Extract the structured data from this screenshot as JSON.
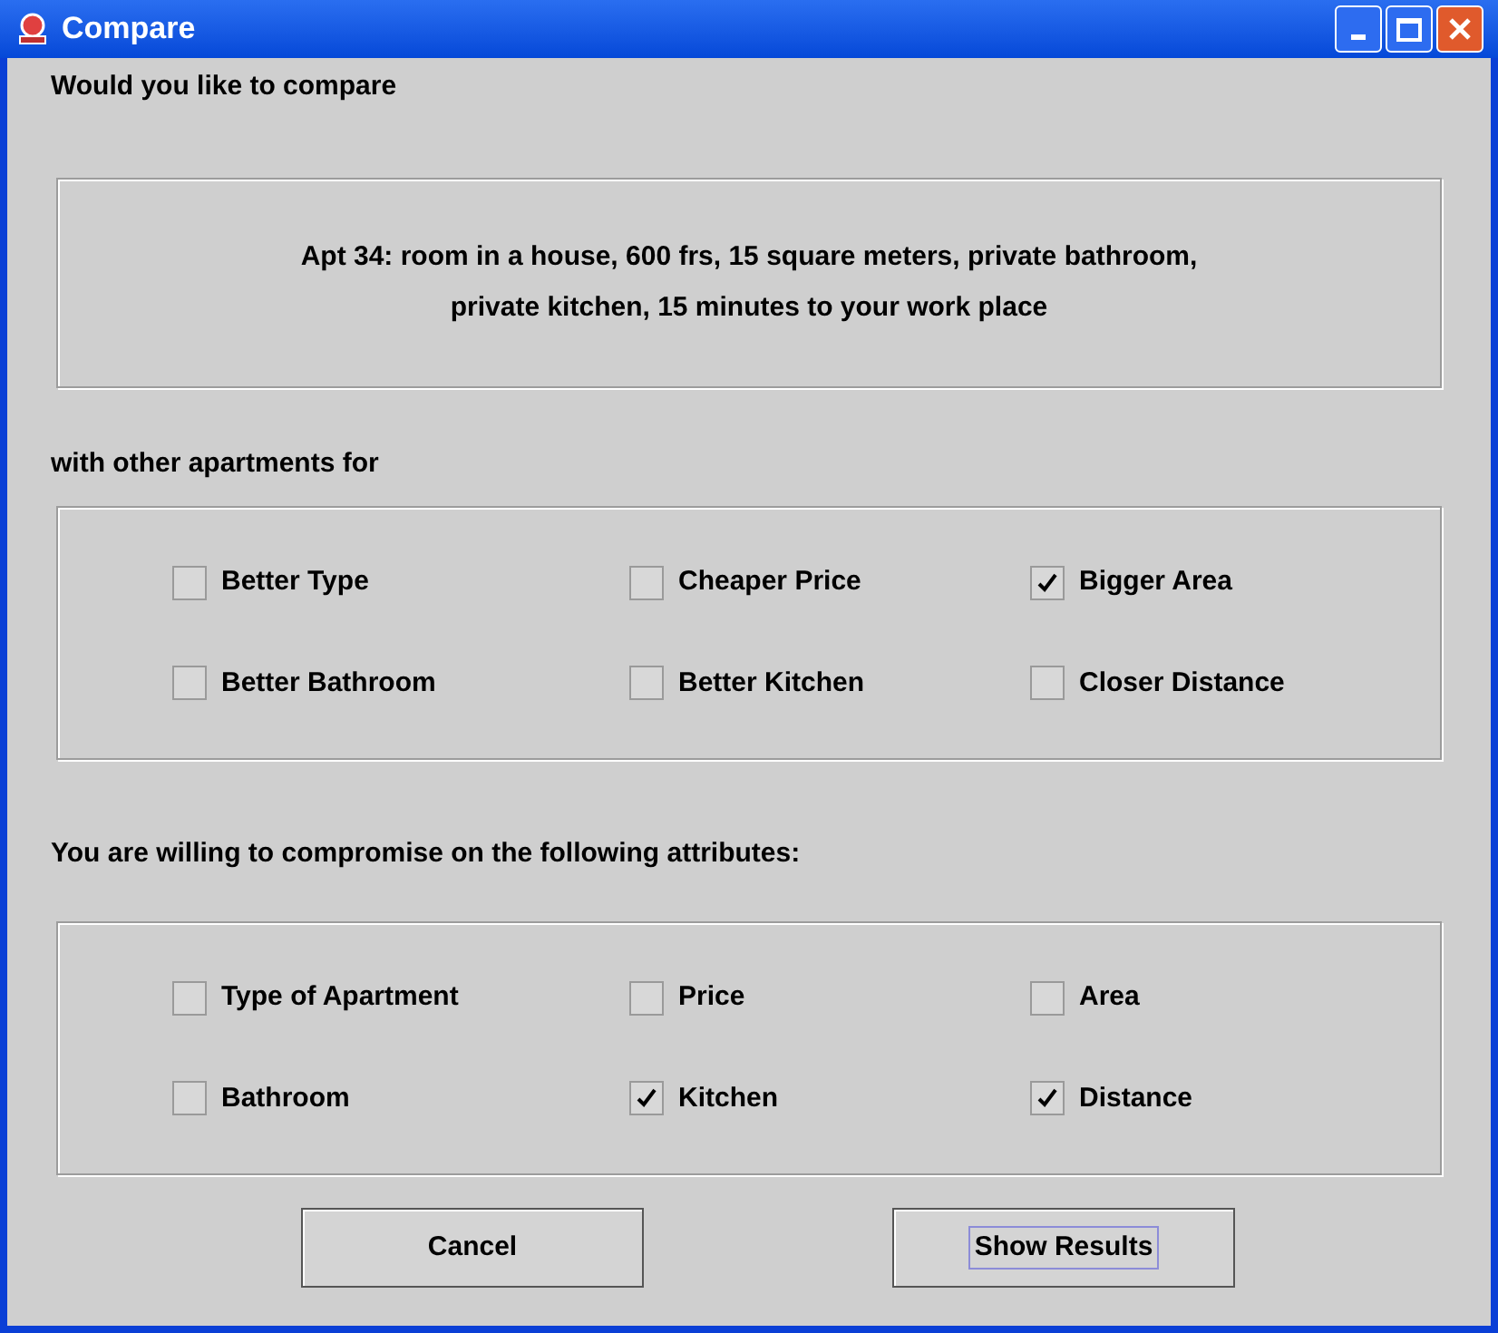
{
  "window": {
    "title": "Compare"
  },
  "prompt": "Would you like to compare",
  "apartment": {
    "line_1": "Apt 34: room in a house, 600 frs, 15 square meters, private bathroom,",
    "line_2": "private kitchen, 15 minutes to your work place"
  },
  "criteria_label": "with other apartments  for",
  "criteria": [
    {
      "label": "Better Type",
      "checked": false
    },
    {
      "label": "Cheaper Price",
      "checked": false
    },
    {
      "label": "Bigger Area",
      "checked": true
    },
    {
      "label": "Better Bathroom",
      "checked": false
    },
    {
      "label": "Better Kitchen",
      "checked": false
    },
    {
      "label": "Closer Distance",
      "checked": false
    }
  ],
  "compromise_label": "You are willing to compromise on the following attributes:",
  "compromise": [
    {
      "label": "Type of Apartment",
      "checked": false
    },
    {
      "label": "Price",
      "checked": false
    },
    {
      "label": "Area",
      "checked": false
    },
    {
      "label": "Bathroom",
      "checked": false
    },
    {
      "label": "Kitchen",
      "checked": true
    },
    {
      "label": "Distance",
      "checked": true
    }
  ],
  "buttons": [
    {
      "label": "Cancel",
      "focused": false
    },
    {
      "label": "Show Results",
      "focused": true
    }
  ]
}
